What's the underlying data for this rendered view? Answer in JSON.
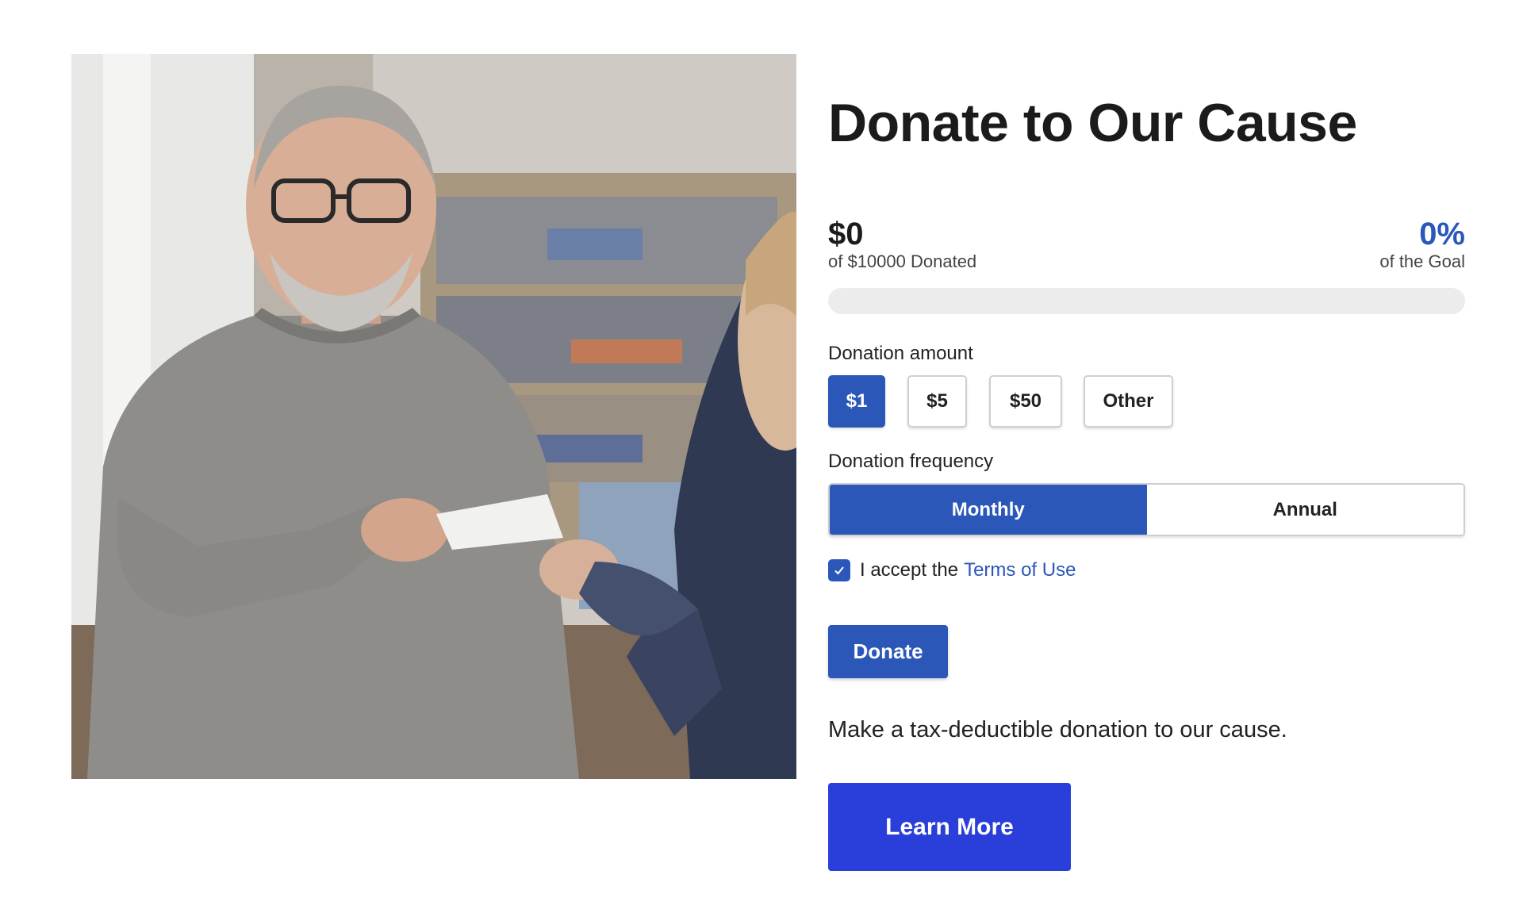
{
  "hero_image": {
    "icon": "donation-handover-photo"
  },
  "title": "Donate to Our Cause",
  "stats": {
    "amount_raised": "$0",
    "amount_caption": "of $10000 Donated",
    "percent": "0%",
    "percent_caption": "of the Goal",
    "progress_fraction": 0
  },
  "donation_amount": {
    "label": "Donation amount",
    "options": [
      "$1",
      "$5",
      "$50",
      "Other"
    ],
    "selected": "$1"
  },
  "donation_frequency": {
    "label": "Donation frequency",
    "options": [
      "Monthly",
      "Annual"
    ],
    "selected": "Monthly"
  },
  "terms": {
    "checked": true,
    "text": "I accept the",
    "link_text": "Terms of Use"
  },
  "donate_button": "Donate",
  "tagline": "Make a tax-deductible donation to our cause.",
  "learn_more_button": "Learn More",
  "colors": {
    "primary": "#2a57b8",
    "learn_more": "#2a3fd9",
    "progress_track": "#ececec"
  }
}
